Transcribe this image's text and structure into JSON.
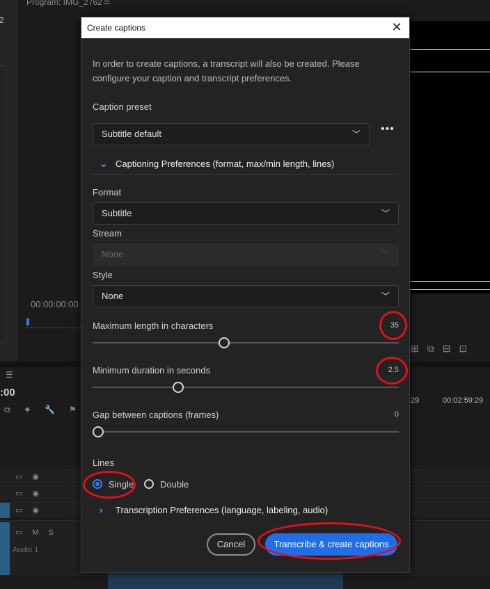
{
  "background": {
    "program_title": "Program: IMG_2762",
    "panel_number": "2",
    "timecode": "00:00:00:00",
    "timeline_time": ":00",
    "tc_right_a": "29",
    "tc_right_b": "00:02:59:29",
    "audio_track_label": "Audio 1"
  },
  "dialog": {
    "title": "Create captions",
    "intro": "In order to create captions, a transcript will also be created. Please configure your caption and transcript preferences.",
    "caption_preset_label": "Caption preset",
    "caption_preset_value": "Subtitle default",
    "more_label": "•••",
    "captioning_section": "Captioning Preferences (format, max/min length, lines)",
    "format_label": "Format",
    "format_value": "Subtitle",
    "stream_label": "Stream",
    "stream_value": "None",
    "style_label": "Style",
    "style_value": "None",
    "max_length_label": "Maximum length in characters",
    "max_length_value": "35",
    "max_length_fraction": 0.43,
    "min_duration_label": "Minimum duration in seconds",
    "min_duration_value": "2.5",
    "min_duration_fraction": 0.28,
    "gap_label": "Gap between captions (frames)",
    "gap_value": "0",
    "gap_fraction": 0.0,
    "lines_label": "Lines",
    "lines_options": [
      "Single",
      "Double"
    ],
    "lines_selected": "Single",
    "transcription_section": "Transcription Preferences (language, labeling, audio)",
    "cancel_label": "Cancel",
    "primary_label": "Transcribe & create captions"
  },
  "colors": {
    "accent": "#1f6ee8",
    "annotation": "#e0101a",
    "dialog_bg": "#232323"
  }
}
